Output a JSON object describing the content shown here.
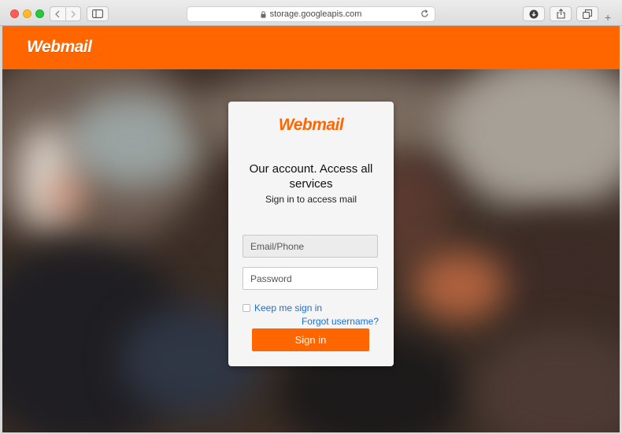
{
  "browser": {
    "url": "storage.googleapis.com",
    "icons": [
      "close-dot",
      "minimize-dot",
      "zoom-dot",
      "back-chevron-icon",
      "forward-chevron-icon",
      "sidebar-icon",
      "lock-icon",
      "reload-icon",
      "download-icon",
      "share-icon",
      "tabs-icon",
      "plus-icon"
    ]
  },
  "header": {
    "logo": "Webmail"
  },
  "login": {
    "logo": "Webmail",
    "title": "Our account. Access all services",
    "subtitle": "Sign in to access mail",
    "email_placeholder": "Email/Phone",
    "password_placeholder": "Password",
    "remember_label": "Keep me sign in",
    "forgot_label": "Forgot username?",
    "signin_label": "Sign in"
  },
  "colors": {
    "brand": "#ff6600",
    "link": "#1a6fd6"
  }
}
